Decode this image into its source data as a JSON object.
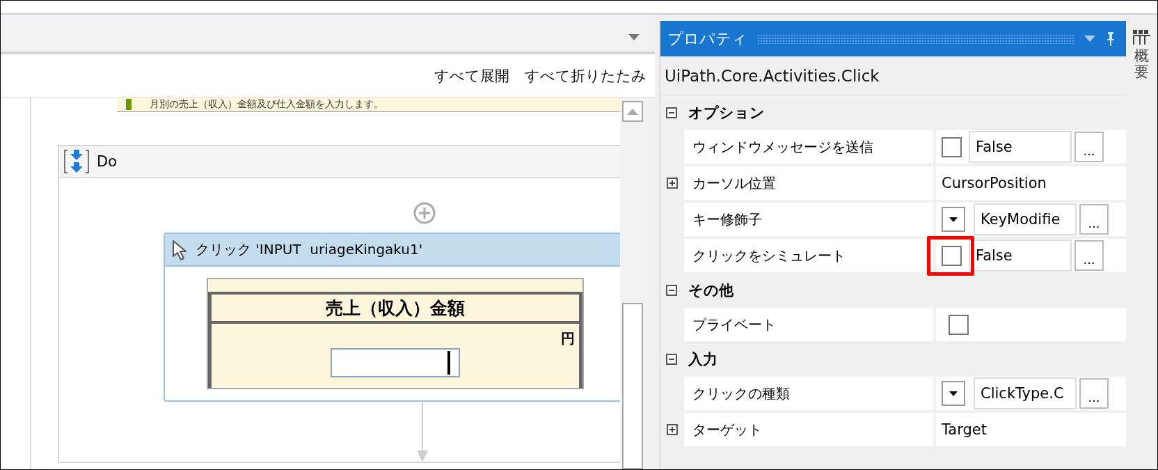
{
  "designer": {
    "toolbar": {
      "buttons": [
        {
          "label": "すべて展開"
        },
        {
          "label": "すべて折りたたみ"
        }
      ]
    },
    "annotation": "月別の売上（収入）金額及び仕入金額を入力します。",
    "sequence": {
      "title": "Do",
      "activity": {
        "title": "クリック 'INPUT  uriageKingaku1'",
        "screenshot": {
          "heading": "売上（収入）金額",
          "unit": "円"
        }
      }
    }
  },
  "properties": {
    "title": "プロパティ",
    "type_name": "UiPath.Core.Activities.Click",
    "categories": [
      {
        "name": "オプション",
        "expanded": true,
        "rows": [
          {
            "kind": "checkbox_value",
            "label": "ウィンドウメッセージを送信",
            "checked": false,
            "value": "False",
            "button": "...",
            "highlighted": false
          },
          {
            "kind": "expandable",
            "label": "カーソル位置",
            "value": "CursorPosition",
            "expanded": false
          },
          {
            "kind": "dropdown_value",
            "label": "キー修飾子",
            "value": "KeyModifie",
            "button": "..."
          },
          {
            "kind": "checkbox_value",
            "label": "クリックをシミュレート",
            "checked": false,
            "value": "False",
            "button": "...",
            "highlighted": true
          }
        ]
      },
      {
        "name": "その他",
        "expanded": true,
        "rows": [
          {
            "kind": "checkbox",
            "label": "プライベート",
            "checked": false
          }
        ]
      },
      {
        "name": "入力",
        "expanded": true,
        "rows": [
          {
            "kind": "dropdown_value",
            "label": "クリックの種類",
            "value": "ClickType.C",
            "button": "..."
          },
          {
            "kind": "expandable",
            "label": "ターゲット",
            "value": "Target",
            "expanded": false
          }
        ]
      }
    ]
  },
  "side_tab": {
    "label": "概要"
  }
}
